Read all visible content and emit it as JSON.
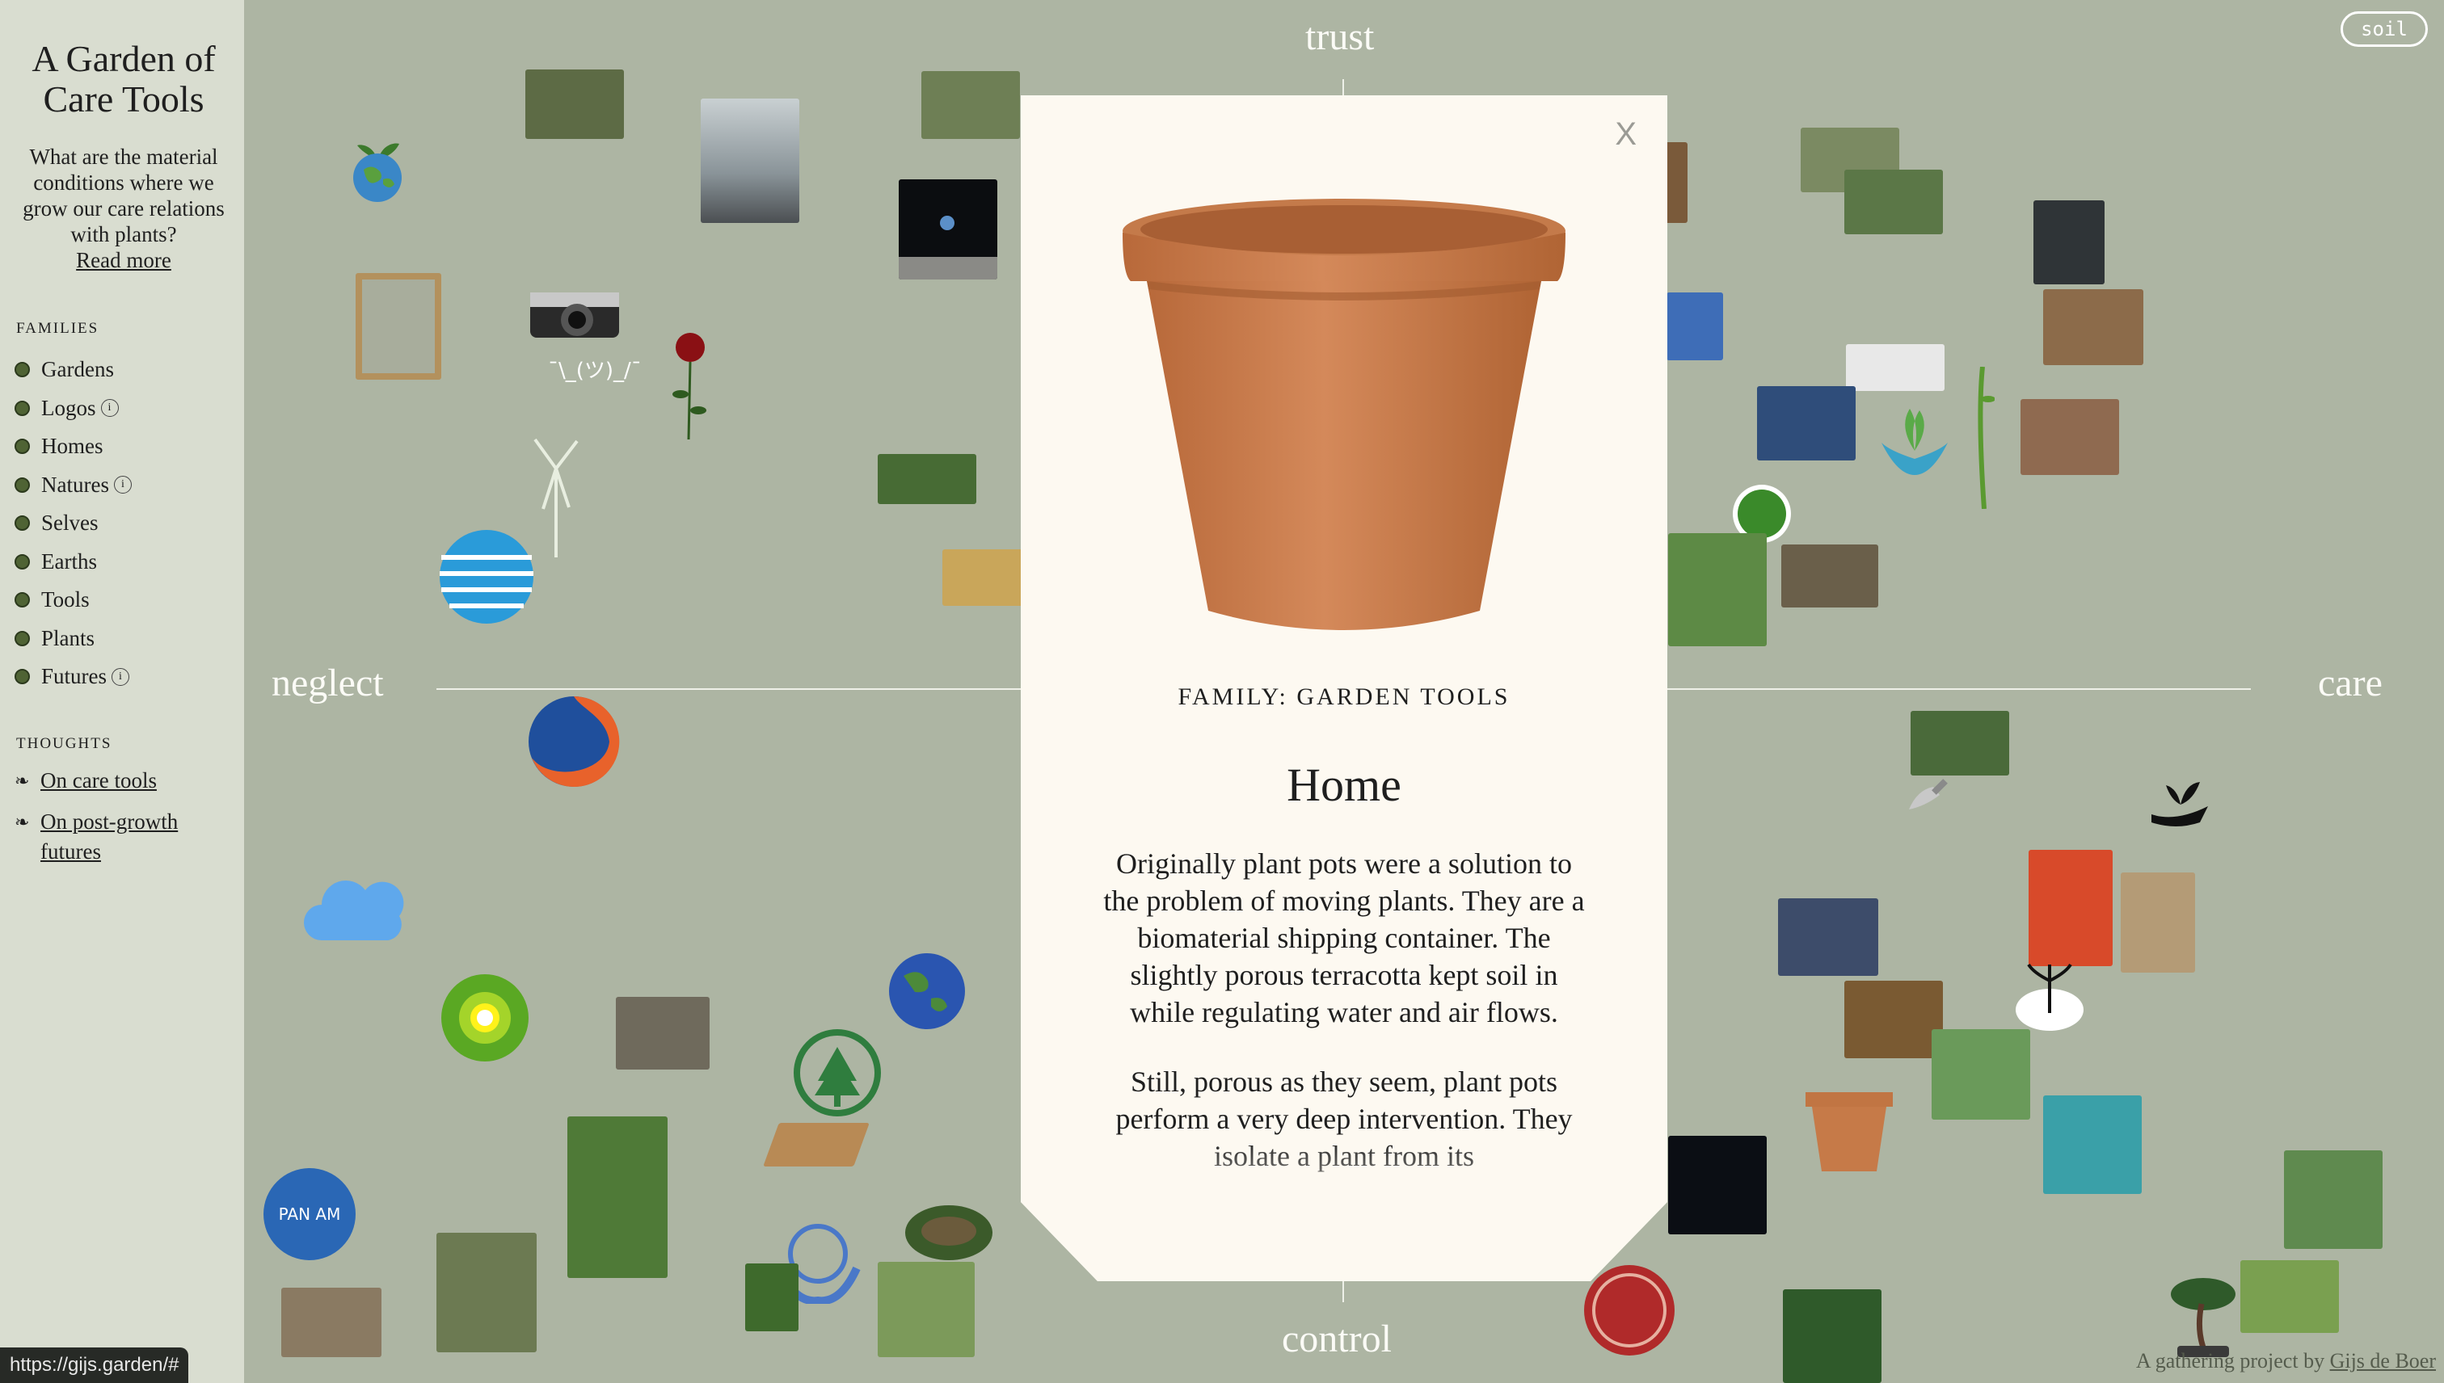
{
  "site": {
    "title": "A Garden of Care Tools",
    "intro": "What are the material conditions where we grow our care relations with plants?",
    "read_more": "Read more"
  },
  "families": {
    "heading": "FAMILIES",
    "items": [
      {
        "label": "Gardens",
        "info": false
      },
      {
        "label": "Logos",
        "info": true
      },
      {
        "label": "Homes",
        "info": false
      },
      {
        "label": "Natures",
        "info": true
      },
      {
        "label": "Selves",
        "info": false
      },
      {
        "label": "Earths",
        "info": false
      },
      {
        "label": "Tools",
        "info": false
      },
      {
        "label": "Plants",
        "info": false
      },
      {
        "label": "Futures",
        "info": true
      }
    ],
    "dot_color": "#4f6334"
  },
  "thoughts": {
    "heading": "THOUGHTS",
    "items": [
      {
        "label": "On care tools"
      },
      {
        "label": "On post-growth futures"
      }
    ]
  },
  "axes": {
    "top": "trust",
    "bottom": "control",
    "left": "neglect",
    "right": "care"
  },
  "soil_button": "soil",
  "shrug_text": "¯\\_(ツ)_/¯",
  "modal": {
    "close": "X",
    "family": "FAMILY: GARDEN TOOLS",
    "title": "Home",
    "paragraphs": [
      "Originally plant pots were a solution to the problem of moving plants. They are a biomaterial shipping container. The slightly porous terracotta kept soil in while regulating water and air flows.",
      "Still, porous as they seem, plant pots perform a very deep intervention. They isolate a plant from its"
    ]
  },
  "credit": {
    "prefix": "A gathering project by",
    "author": "Gijs de Boer"
  },
  "status_url": "https://gijs.garden/#",
  "colors": {
    "background": "#adb5a3",
    "sidebar": "#d9ddd0",
    "modal": "#fdf9f1",
    "terracotta": "#c67a48"
  }
}
